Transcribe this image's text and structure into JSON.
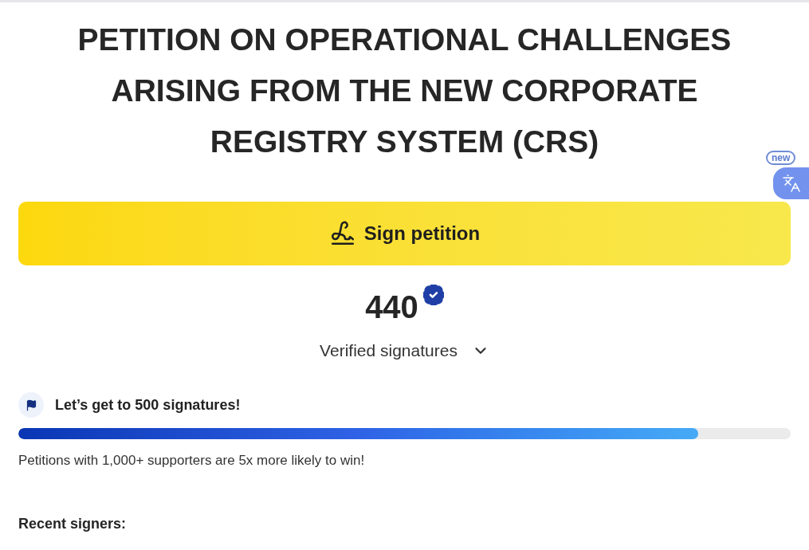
{
  "header": {
    "title": "PETITION ON OPERATIONAL CHALLENGES ARISING FROM THE NEW CORPORATE REGISTRY SYSTEM (CRS)"
  },
  "translate_widget": {
    "badge": "new"
  },
  "sign_button": {
    "label": "Sign petition"
  },
  "signatures": {
    "count": "440",
    "label": "Verified signatures",
    "expanded": false
  },
  "goal": {
    "text": "Let’s get to 500 signatures!",
    "level": 0.88,
    "note": "Petitions with 1,000+ supporters are 5x more likely to win!"
  },
  "recent_signers": {
    "heading": "Recent signers:"
  }
}
